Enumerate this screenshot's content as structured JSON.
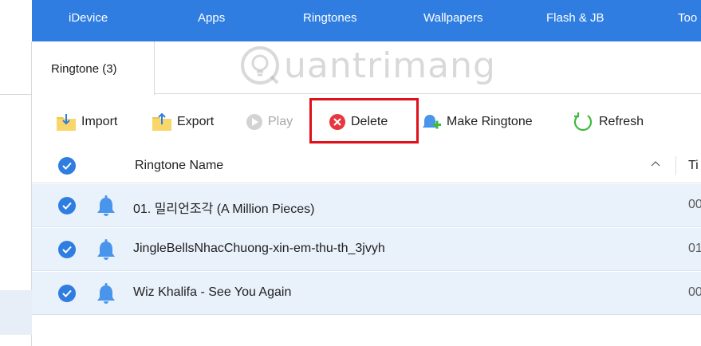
{
  "nav": {
    "items": [
      "iDevice",
      "Apps",
      "Ringtones",
      "Wallpapers",
      "Flash & JB",
      "Too"
    ]
  },
  "tab": {
    "label": "Ringtone (3)"
  },
  "watermark": {
    "text": "uantrimang"
  },
  "toolbar": {
    "import_label": "Import",
    "export_label": "Export",
    "play_label": "Play",
    "delete_label": "Delete",
    "make_ringtone_label": "Make Ringtone",
    "refresh_label": "Refresh"
  },
  "table": {
    "columns": {
      "name": "Ringtone Name",
      "time": "Ti"
    },
    "rows": [
      {
        "name": "01. 밀리언조각 (A Million Pieces)",
        "time": "00"
      },
      {
        "name": "JingleBellsNhacChuong-xin-em-thu-th_3jvyh",
        "time": "01"
      },
      {
        "name": "Wiz Khalifa - See You Again",
        "time": "00"
      }
    ]
  },
  "colors": {
    "nav_bg": "#2f7de1",
    "accent": "#2f7de1",
    "row_selected_bg": "#e9f1fb",
    "delete_icon": "#e8363f",
    "highlight_box": "#e0101a",
    "refresh_icon": "#3dbb3d",
    "folder_icon": "#f4c542"
  }
}
